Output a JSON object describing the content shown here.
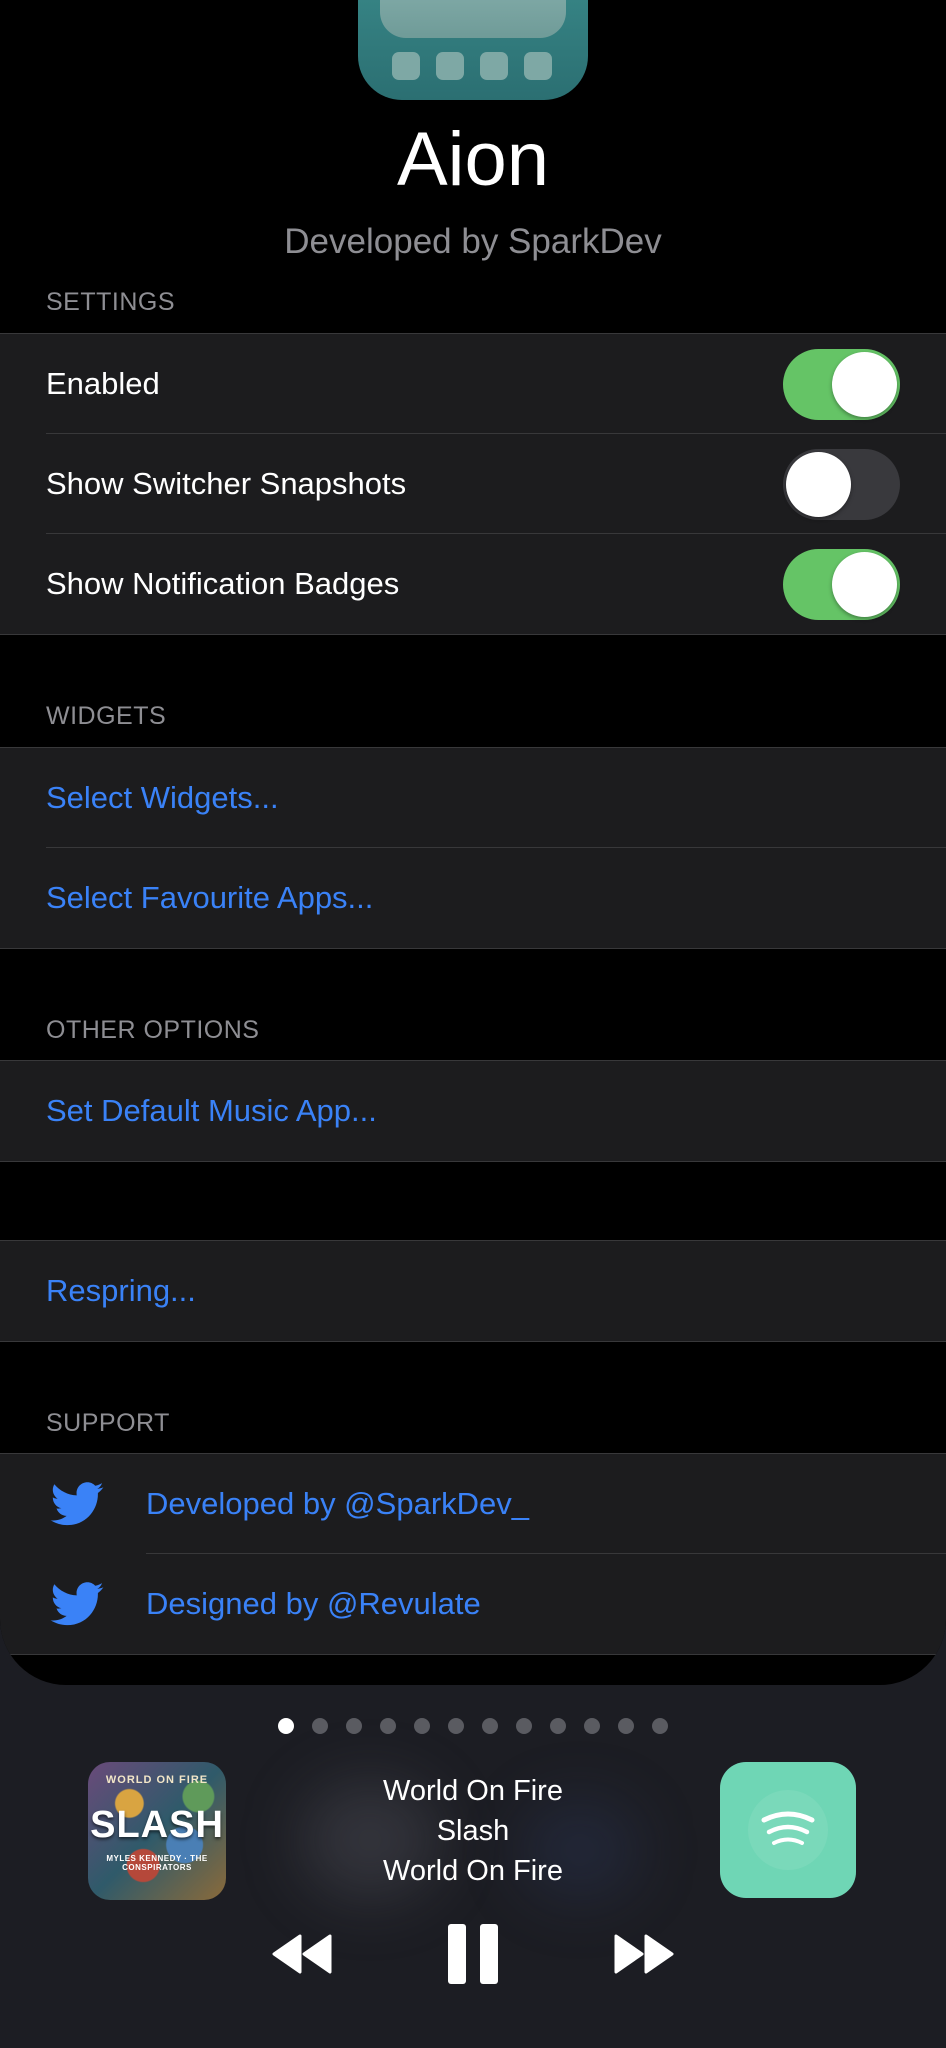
{
  "app": {
    "title": "Aion",
    "subtitle": "Developed by SparkDev"
  },
  "settings": {
    "header": "SETTINGS",
    "rows": [
      {
        "label": "Enabled",
        "on": true
      },
      {
        "label": "Show Switcher Snapshots",
        "on": false
      },
      {
        "label": "Show Notification Badges",
        "on": true
      }
    ]
  },
  "widgets": {
    "header": "WIDGETS",
    "select_widgets": "Select Widgets...",
    "select_favourites": "Select Favourite Apps..."
  },
  "other_options": {
    "header": "OTHER OPTIONS",
    "default_music": "Set Default Music App..."
  },
  "respring": {
    "label": "Respring..."
  },
  "support": {
    "header": "SUPPORT",
    "developed_by": "Developed by @SparkDev_",
    "designed_by": "Designed by @Revulate"
  },
  "page_dots": {
    "count": 12,
    "active_index": 0
  },
  "now_playing": {
    "album_art": {
      "top_text": "WORLD ON FIRE",
      "main_text": "SLASH",
      "sub_text": "MYLES KENNEDY · THE CONSPIRATORS"
    },
    "song": "World On Fire",
    "artist": "Slash",
    "album": "World On Fire",
    "app_icon": "spotify-icon",
    "controls": [
      "rewind-icon",
      "pause-icon",
      "fast-forward-icon"
    ]
  },
  "colors": {
    "link": "#3a82f7",
    "toggle_on": "#65c466",
    "toggle_off": "#39393d",
    "spotify_bg": "#6fd6b5"
  }
}
